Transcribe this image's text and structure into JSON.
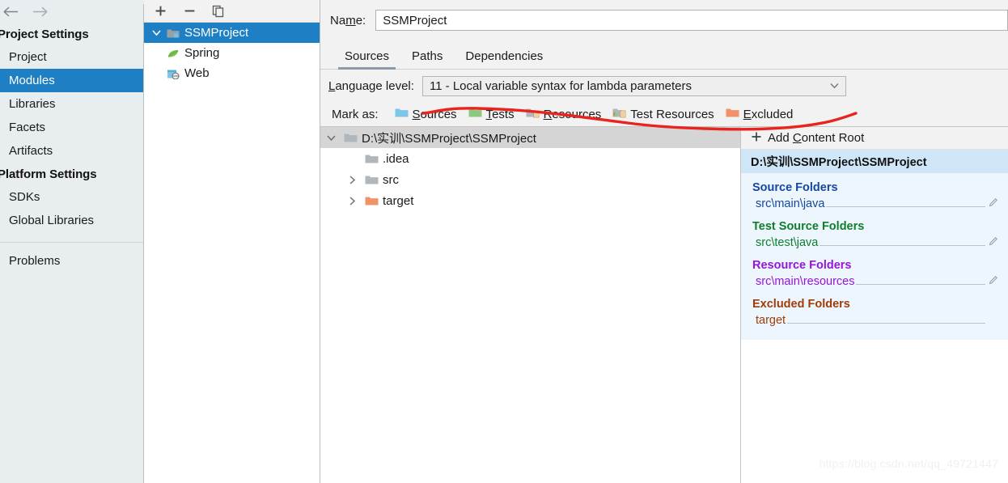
{
  "sidebar": {
    "nav": {
      "back_icon": "arrow-left-icon",
      "back_glyph": "←",
      "forward_icon": "arrow-right-icon",
      "forward_glyph": "→"
    },
    "groups": [
      {
        "title": "Project Settings",
        "items": [
          {
            "label": "Project",
            "selected": false
          },
          {
            "label": "Modules",
            "selected": true
          },
          {
            "label": "Libraries",
            "selected": false
          },
          {
            "label": "Facets",
            "selected": false
          },
          {
            "label": "Artifacts",
            "selected": false
          }
        ]
      },
      {
        "title": "Platform Settings",
        "items": [
          {
            "label": "SDKs",
            "selected": false
          },
          {
            "label": "Global Libraries",
            "selected": false
          }
        ]
      }
    ],
    "problems_label": "Problems"
  },
  "module_panel": {
    "toolbar": {
      "add_label": "+",
      "remove_label": "−",
      "copy_label": "copy"
    },
    "tree": [
      {
        "label": "SSMProject",
        "icon": "module-folder-icon",
        "selected": true,
        "expanded": true,
        "depth": 0
      },
      {
        "label": "Spring",
        "icon": "spring-leaf-icon",
        "selected": false,
        "depth": 1
      },
      {
        "label": "Web",
        "icon": "web-facet-icon",
        "selected": false,
        "depth": 1
      }
    ]
  },
  "detail": {
    "name_label": "Name:",
    "name_mnemonic": "m",
    "name_value": "SSMProject",
    "tabs": [
      {
        "label": "Sources",
        "active": true
      },
      {
        "label": "Paths",
        "active": false
      },
      {
        "label": "Dependencies",
        "active": false
      }
    ],
    "language_level_label": "Language level:",
    "language_level_mnemonic": "L",
    "language_level_value": "11 - Local variable syntax for lambda parameters",
    "mark_as_label": "Mark as:",
    "mark_as_buttons": [
      {
        "label": "Sources",
        "mnemonic": "S",
        "rest": "ources",
        "icon": "sources-folder-icon",
        "color": "#7ec6e8"
      },
      {
        "label": "Tests",
        "mnemonic": "T",
        "rest": "ests",
        "icon": "tests-folder-icon",
        "color": "#8cc97f"
      },
      {
        "label": "Resources",
        "mnemonic": "R",
        "rest": "esources",
        "icon": "resources-folder-icon",
        "color": "#b0b7bb"
      },
      {
        "label": "Test Resources",
        "mnemonic": "",
        "rest": "Test Resources",
        "icon": "test-resources-folder-icon",
        "color": "#b0b7bb"
      },
      {
        "label": "Excluded",
        "mnemonic": "E",
        "rest": "xcluded",
        "icon": "excluded-folder-icon",
        "color": "#f0936a"
      }
    ]
  },
  "folder_tree": [
    {
      "label": "D:\\实训\\SSMProject\\SSMProject",
      "icon": "content-root-folder-icon",
      "color": "#b0b7bb",
      "depth": 0,
      "twisty": "expanded",
      "selected": true
    },
    {
      "label": ".idea",
      "icon": "folder-icon",
      "color": "#b0b7bb",
      "depth": 1,
      "twisty": "none",
      "selected": false
    },
    {
      "label": "src",
      "icon": "folder-icon",
      "color": "#b0b7bb",
      "depth": 1,
      "twisty": "collapsed",
      "selected": false
    },
    {
      "label": "target",
      "icon": "excluded-folder-icon",
      "color": "#f0936a",
      "depth": 1,
      "twisty": "collapsed",
      "selected": false
    }
  ],
  "content_roots": {
    "add_label": "Add Content Root",
    "add_mnemonic": "C",
    "add_prefix": "Add ",
    "add_suffix": "ontent Root",
    "root_path": "D:\\实训\\SSMProject\\SSMProject",
    "groups": [
      {
        "title": "Source Folders",
        "color": "#14479e",
        "entries": [
          {
            "path": "src\\main\\java"
          }
        ]
      },
      {
        "title": "Test Source Folders",
        "color": "#0f7d2e",
        "entries": [
          {
            "path": "src\\test\\java"
          }
        ]
      },
      {
        "title": "Resource Folders",
        "color": "#9317d6",
        "entries": [
          {
            "path": "src\\main\\resources"
          }
        ]
      },
      {
        "title": "Excluded Folders",
        "color": "#a03c0a",
        "entries": [
          {
            "path": "target"
          }
        ]
      }
    ]
  },
  "watermark": "https://blog.csdn.net/qq_49721447",
  "annotation": {
    "name": "red-underline-scribble",
    "color": "#e8241e"
  },
  "colors": {
    "accent_blue": "#1e7fc4",
    "sidebar_bg": "#e8edf0",
    "panel_bg": "#f2f2f2",
    "roots_bg": "#edf6fd",
    "roots_header_bg": "#cfe6f7"
  }
}
